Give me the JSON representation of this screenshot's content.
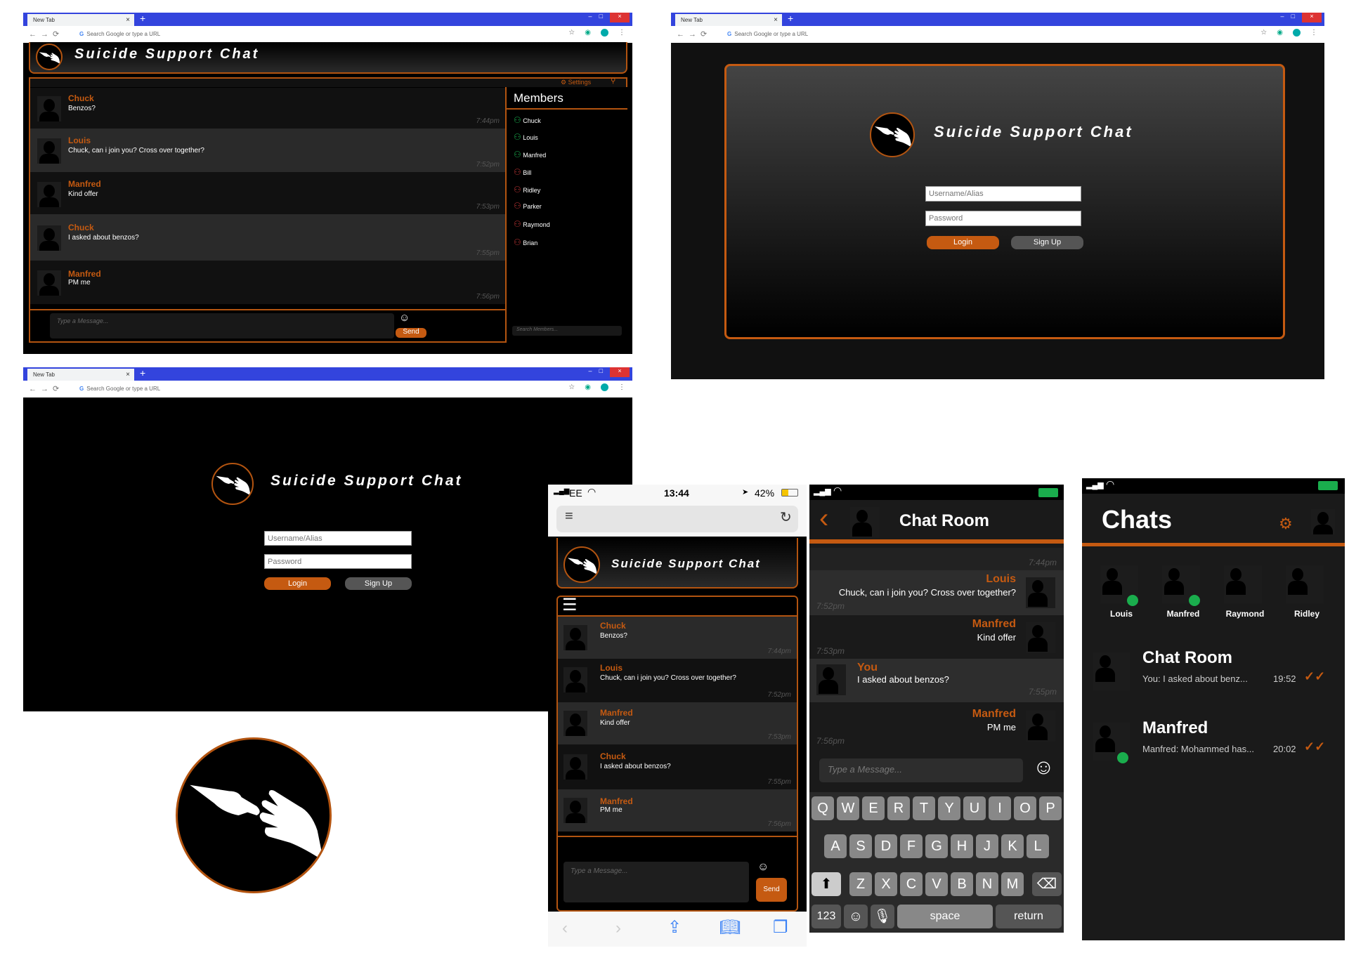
{
  "browser": {
    "tab_title": "New Tab",
    "omnibox_placeholder": "Search Google or type a URL",
    "tab_close": "×",
    "new_tab": "+",
    "win_min": "–",
    "win_max": "□",
    "win_close": "×"
  },
  "app_title": "Suicide Support Chat",
  "colors": {
    "accent": "#c55a11",
    "background": "#000000",
    "online": "#1aad4d"
  },
  "desktop_chat": {
    "settings_label": "Settings",
    "members_title": "Members",
    "message_placeholder": "Type a Message...",
    "send_label": "Send",
    "search_members_placeholder": "Search Members...",
    "messages": [
      {
        "name": "Chuck",
        "text": "Benzos?",
        "time": "7:44pm"
      },
      {
        "name": "Louis",
        "text": "Chuck, can i join you? Cross over together?",
        "time": "7:52pm"
      },
      {
        "name": "Manfred",
        "text": "Kind offer",
        "time": "7:53pm"
      },
      {
        "name": "Chuck",
        "text": "I asked about benzos?",
        "time": "7:55pm"
      },
      {
        "name": "Manfred",
        "text": "PM me",
        "time": "7:56pm"
      }
    ],
    "members": [
      {
        "name": "Chuck",
        "status": "online"
      },
      {
        "name": "Louis",
        "status": "online"
      },
      {
        "name": "Manfred",
        "status": "online"
      },
      {
        "name": "Bill",
        "status": "offline"
      },
      {
        "name": "Ridley",
        "status": "offline"
      },
      {
        "name": "Parker",
        "status": "offline"
      },
      {
        "name": "Raymond",
        "status": "offline"
      },
      {
        "name": "Brian",
        "status": "offline"
      }
    ]
  },
  "login": {
    "username_placeholder": "Username/Alias",
    "password_placeholder": "Password",
    "login_label": "Login",
    "signup_label": "Sign Up"
  },
  "mobile_web": {
    "status": {
      "carrier": "EE",
      "time": "13:44",
      "battery": "42%"
    },
    "message_placeholder": "Type a Message...",
    "send_label": "Send",
    "messages": [
      {
        "name": "Chuck",
        "text": "Benzos?",
        "time": "7:44pm"
      },
      {
        "name": "Louis",
        "text": "Chuck, can i join you? Cross over together?",
        "time": "7:52pm"
      },
      {
        "name": "Manfred",
        "text": "Kind offer",
        "time": "7:53pm"
      },
      {
        "name": "Chuck",
        "text": "I asked about benzos?",
        "time": "7:55pm"
      },
      {
        "name": "Manfred",
        "text": "PM me",
        "time": "7:56pm"
      }
    ]
  },
  "app_chat_room": {
    "title": "Chat Room",
    "top_time": "7:44pm",
    "messages": [
      {
        "name": "Louis",
        "text": "Chuck, can i join you? Cross over together?",
        "time": "7:52pm",
        "side": "right"
      },
      {
        "name": "Manfred",
        "text": "Kind offer",
        "time": "7:53pm",
        "side": "right"
      },
      {
        "name": "You",
        "text": "I asked about benzos?",
        "time": "7:55pm",
        "side": "left"
      },
      {
        "name": "Manfred",
        "text": "PM me",
        "time": "7:56pm",
        "side": "right"
      }
    ],
    "message_placeholder": "Type a Message...",
    "keyboard": {
      "row1": [
        "Q",
        "W",
        "E",
        "R",
        "T",
        "Y",
        "U",
        "I",
        "O",
        "P"
      ],
      "row2": [
        "A",
        "S",
        "D",
        "F",
        "G",
        "H",
        "J",
        "K",
        "L"
      ],
      "row3": [
        "Z",
        "X",
        "C",
        "V",
        "B",
        "N",
        "M"
      ],
      "numbers": "123",
      "space": "space",
      "return": "return"
    }
  },
  "app_chats": {
    "title": "Chats",
    "contacts": [
      {
        "name": "Louis",
        "online": true
      },
      {
        "name": "Manfred",
        "online": true
      },
      {
        "name": "Raymond",
        "online": false
      },
      {
        "name": "Ridley",
        "online": false
      }
    ],
    "conversations": [
      {
        "title": "Chat Room",
        "preview": "You: I asked about benz...",
        "time": "19:52",
        "online": false
      },
      {
        "title": "Manfred",
        "preview": "Manfred: Mohammed has...",
        "time": "20:02",
        "online": true
      }
    ]
  }
}
